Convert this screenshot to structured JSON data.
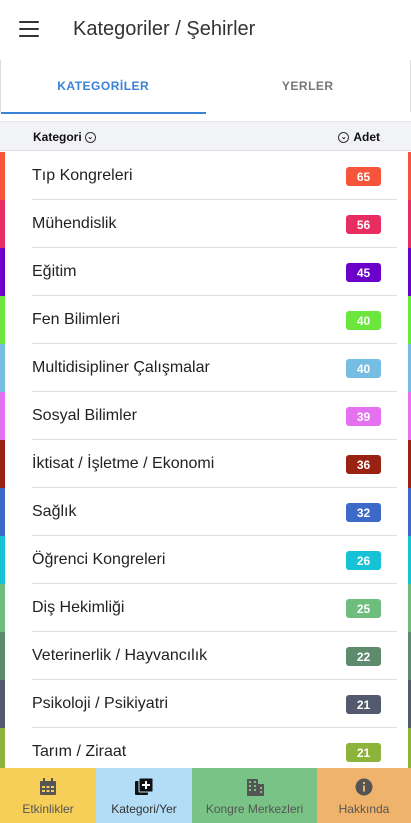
{
  "appbar": {
    "title": "Kategoriler / Şehirler"
  },
  "tabs": [
    {
      "label": "KATEGORİLER",
      "active": true
    },
    {
      "label": "YERLER",
      "active": false
    }
  ],
  "list_header": {
    "left_label": "Kategori",
    "right_label": "Adet"
  },
  "categories": [
    {
      "label": "Tıp Kongreleri",
      "count": "65",
      "color": "#f4553b"
    },
    {
      "label": "Mühendislik",
      "count": "56",
      "color": "#e82e61"
    },
    {
      "label": "Eğitim",
      "count": "45",
      "color": "#6b00c9"
    },
    {
      "label": "Fen Bilimleri",
      "count": "40",
      "color": "#6be63d"
    },
    {
      "label": "Multidisipliner Çalışmalar",
      "count": "40",
      "color": "#75bde2"
    },
    {
      "label": "Sosyal Bilimler",
      "count": "39",
      "color": "#e570f0"
    },
    {
      "label": "İktisat / İşletme / Ekonomi",
      "count": "36",
      "color": "#9a2212"
    },
    {
      "label": "Sağlık",
      "count": "32",
      "color": "#3d6ac9"
    },
    {
      "label": "Öğrenci Kongreleri",
      "count": "26",
      "color": "#16c3d6"
    },
    {
      "label": "Diş Hekimliği",
      "count": "25",
      "color": "#6ebd7c"
    },
    {
      "label": "Veterinerlik / Hayvancılık",
      "count": "22",
      "color": "#5e8a6e"
    },
    {
      "label": "Psikoloji / Psikiyatri",
      "count": "21",
      "color": "#545a6e"
    },
    {
      "label": "Tarım / Ziraat",
      "count": "21",
      "color": "#8cb33a"
    }
  ],
  "bottom_nav": [
    {
      "label": "Etkinlikler",
      "icon": "calendar-icon",
      "bg": "#f5cf57",
      "active": false
    },
    {
      "label": "Kategori/Yer",
      "icon": "add-library-icon",
      "bg": "#b3dcf7",
      "active": true
    },
    {
      "label": "Kongre Merkezleri",
      "icon": "building-icon",
      "bg": "#79c387",
      "active": false
    },
    {
      "label": "Hakkında",
      "icon": "info-icon",
      "bg": "#f0b36b",
      "active": false
    }
  ]
}
